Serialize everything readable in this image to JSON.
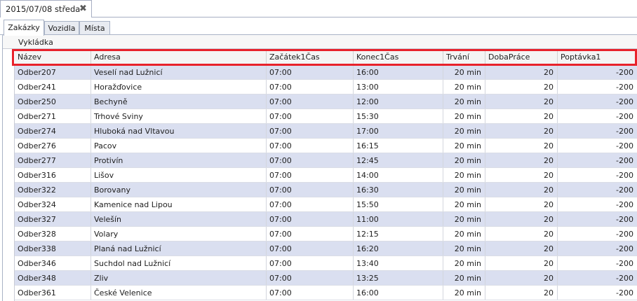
{
  "document_tab": {
    "title": "2015/07/08 středa",
    "close_glyph": "✖"
  },
  "tabs": [
    {
      "label": "Zakázky",
      "active": true
    },
    {
      "label": "Vozidla",
      "active": false
    },
    {
      "label": "Místa",
      "active": false
    }
  ],
  "group": {
    "label": "Vykládka"
  },
  "columns": [
    "Název",
    "Adresa",
    "Začátek1Čas",
    "Konec1Čas",
    "Trvání",
    "DobaPráce",
    "Poptávka1"
  ],
  "rows": [
    [
      "Odber207",
      "Veselí nad Lužnicí",
      "07:00",
      "16:00",
      "20 min",
      "20",
      "-200"
    ],
    [
      "Odber241",
      "Horažďovice",
      "07:00",
      "13:00",
      "20 min",
      "20",
      "-200"
    ],
    [
      "Odber250",
      "Bechyně",
      "07:00",
      "12:00",
      "20 min",
      "20",
      "-200"
    ],
    [
      "Odber271",
      "Trhové Sviny",
      "07:00",
      "15:30",
      "20 min",
      "20",
      "-200"
    ],
    [
      "Odber274",
      "Hluboká nad Vltavou",
      "07:00",
      "17:00",
      "20 min",
      "20",
      "-200"
    ],
    [
      "Odber276",
      "Pacov",
      "07:00",
      "16:15",
      "20 min",
      "20",
      "-200"
    ],
    [
      "Odber277",
      "Protivín",
      "07:00",
      "12:45",
      "20 min",
      "20",
      "-200"
    ],
    [
      "Odber316",
      "Lišov",
      "07:00",
      "14:00",
      "20 min",
      "20",
      "-200"
    ],
    [
      "Odber322",
      "Borovany",
      "07:00",
      "16:30",
      "20 min",
      "20",
      "-200"
    ],
    [
      "Odber324",
      "Kamenice nad Lipou",
      "07:00",
      "15:50",
      "20 min",
      "20",
      "-200"
    ],
    [
      "Odber327",
      "Velešín",
      "07:00",
      "11:00",
      "20 min",
      "20",
      "-200"
    ],
    [
      "Odber328",
      "Volary",
      "07:00",
      "12:15",
      "20 min",
      "20",
      "-200"
    ],
    [
      "Odber338",
      "Planá nad Lužnicí",
      "07:00",
      "16:20",
      "20 min",
      "20",
      "-200"
    ],
    [
      "Odber346",
      "Suchdol nad Lužnicí",
      "07:00",
      "13:40",
      "20 min",
      "20",
      "-200"
    ],
    [
      "Odber348",
      "Zliv",
      "07:00",
      "13:25",
      "20 min",
      "20",
      "-200"
    ],
    [
      "Odber361",
      "České Velenice",
      "07:00",
      "16:00",
      "20 min",
      "20",
      "-200"
    ]
  ],
  "colors": {
    "row_alt": "#dadff0",
    "highlight_border": "#e8222b",
    "grid_line": "#d3d6de"
  }
}
